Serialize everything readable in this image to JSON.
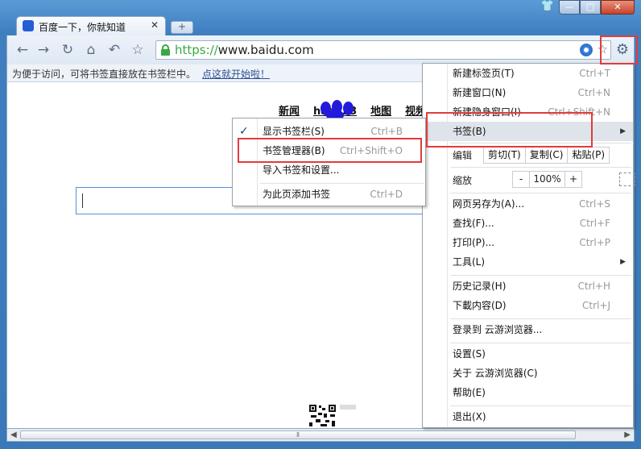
{
  "window": {
    "tab_title": "百度一下，你就知道",
    "tab_close": "✕",
    "newtab": "+",
    "buttons": {
      "shirt": "👕",
      "minimize": "—",
      "maximize": "□",
      "close": "✕"
    }
  },
  "toolbar": {
    "back": "←",
    "forward": "→",
    "reload": "↻",
    "home": "⌂",
    "undo": "↶",
    "star": "☆",
    "url_scheme": "https://",
    "url_host": "www.baidu.com",
    "omni_star": "☆",
    "gear": "⚙"
  },
  "bookmark_bar": {
    "message": "为便于访问，可将书签直接放在书签栏中。",
    "link": "点这就开始啦！"
  },
  "page": {
    "nav": [
      "新闻",
      "hao123",
      "地图",
      "视频"
    ]
  },
  "main_menu": {
    "new_tab": {
      "label": "新建标签页(T)",
      "shortcut": "Ctrl+T"
    },
    "new_window": {
      "label": "新建窗口(N)",
      "shortcut": "Ctrl+N"
    },
    "incognito": {
      "label": "新建隐身窗口(I)",
      "shortcut": "Ctrl+Shift+N"
    },
    "bookmarks": {
      "label": "书签(B)",
      "arrow": "▶"
    },
    "edit": {
      "label": "编辑",
      "cut": "剪切(T)",
      "copy": "复制(C)",
      "paste": "粘贴(P)"
    },
    "zoom": {
      "label": "缩放",
      "minus": "-",
      "value": "100%",
      "plus": "+"
    },
    "save_as": {
      "label": "网页另存为(A)...",
      "shortcut": "Ctrl+S"
    },
    "find": {
      "label": "查找(F)...",
      "shortcut": "Ctrl+F"
    },
    "print": {
      "label": "打印(P)...",
      "shortcut": "Ctrl+P"
    },
    "tools": {
      "label": "工具(L)",
      "arrow": "▶"
    },
    "history": {
      "label": "历史记录(H)",
      "shortcut": "Ctrl+H"
    },
    "downloads": {
      "label": "下載内容(D)",
      "shortcut": "Ctrl+J"
    },
    "signin": {
      "label": "登录到 云游浏览器..."
    },
    "settings": {
      "label": "设置(S)"
    },
    "about": {
      "label": "关于 云游浏览器(C)"
    },
    "help": {
      "label": "帮助(E)"
    },
    "exit": {
      "label": "退出(X)"
    }
  },
  "bookmark_submenu": {
    "show_bar": {
      "label": "显示书签栏(S)",
      "shortcut": "Ctrl+B",
      "check": "✓"
    },
    "manager": {
      "label": "书签管理器(B)",
      "shortcut": "Ctrl+Shift+O"
    },
    "import": {
      "label": "导入书签和设置..."
    },
    "add_page": {
      "label": "为此页添加书签",
      "shortcut": "Ctrl+D"
    }
  },
  "scrollbar": {
    "left": "◀",
    "right": "▶",
    "grip": "⦀"
  },
  "colors": {
    "highlight_box": "#e23b3b",
    "link": "#2e4f8f",
    "secure": "#39a845"
  }
}
